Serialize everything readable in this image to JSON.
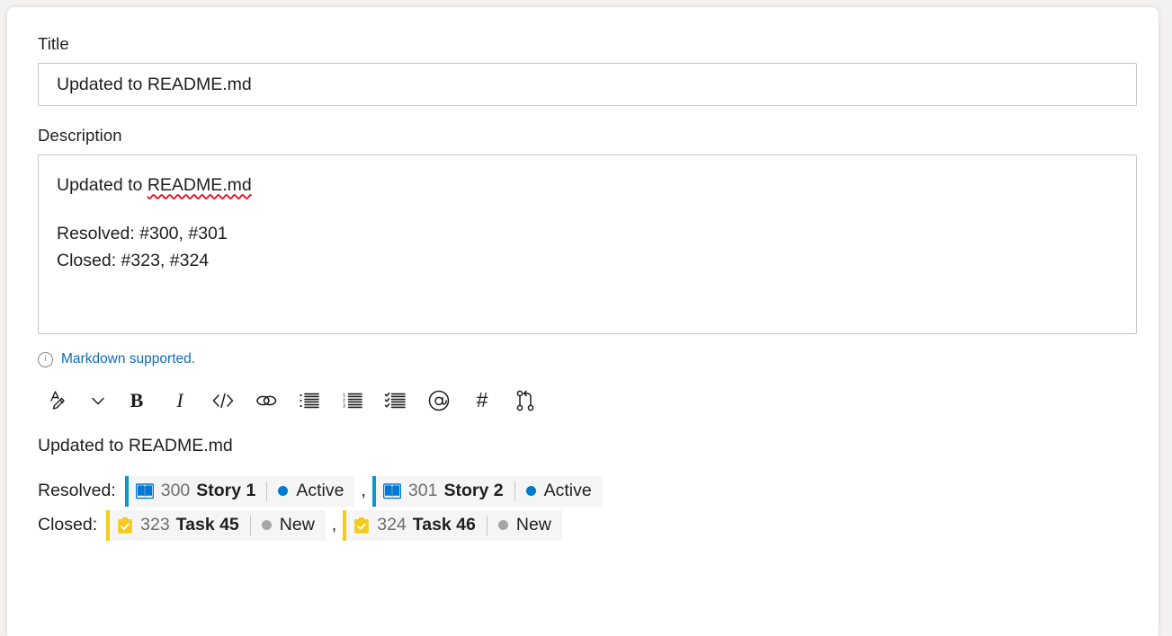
{
  "form": {
    "title_label": "Title",
    "title_value": "Updated to README.md",
    "title_placeholder": "Enter a title",
    "description_label": "Description",
    "description_line1_prefix": "Updated to ",
    "description_line1_misspelled": "README.md",
    "description_line2": "Resolved: #300, #301",
    "description_line3": "Closed: #323, #324",
    "markdown_note": "Markdown supported.",
    "info_icon_glyph": "i"
  },
  "toolbar": {
    "items": [
      {
        "name": "font-style-icon",
        "label": "Font style"
      },
      {
        "name": "chevron-down-icon",
        "label": "More font options"
      },
      {
        "name": "bold-icon",
        "label": "Bold",
        "glyph": "B"
      },
      {
        "name": "italic-icon",
        "label": "Italic",
        "glyph": "I"
      },
      {
        "name": "code-icon",
        "label": "Code",
        "glyph": "</>"
      },
      {
        "name": "link-icon",
        "label": "Link"
      },
      {
        "name": "bulleted-list-icon",
        "label": "Bulleted list"
      },
      {
        "name": "numbered-list-icon",
        "label": "Numbered list"
      },
      {
        "name": "checklist-icon",
        "label": "Checklist"
      },
      {
        "name": "mention-icon",
        "label": "Mention",
        "glyph": "@"
      },
      {
        "name": "hashtag-icon",
        "label": "Work item link",
        "glyph": "#"
      },
      {
        "name": "pull-request-icon",
        "label": "Pull request link"
      }
    ]
  },
  "preview": {
    "paragraph": "Updated to README.md",
    "rows": [
      {
        "label": "Resolved:",
        "chips": [
          {
            "type": "story",
            "icon": "story-book-icon",
            "id": "300",
            "title": "Story 1",
            "state": "Active",
            "state_color": "#007acc",
            "accent_color": "#009ccc"
          },
          {
            "type": "story",
            "icon": "story-book-icon",
            "id": "301",
            "title": "Story 2",
            "state": "Active",
            "state_color": "#007acc",
            "accent_color": "#009ccc"
          }
        ]
      },
      {
        "label": "Closed:",
        "chips": [
          {
            "type": "task",
            "icon": "task-clipboard-check-icon",
            "id": "323",
            "title": "Task 45",
            "state": "New",
            "state_color": "#a6a6a6",
            "accent_color": "#f2cb1d"
          },
          {
            "type": "task",
            "icon": "task-clipboard-check-icon",
            "id": "324",
            "title": "Task 46",
            "state": "New",
            "state_color": "#a6a6a6",
            "accent_color": "#f2cb1d"
          }
        ]
      }
    ],
    "separator": ","
  },
  "colors": {
    "accent_link": "#0f6cbd",
    "story_accent": "#009ccc",
    "task_accent": "#f2cb1d",
    "chip_bg": "#f5f5f5",
    "border": "#c8c6c4",
    "spellcheck": "#e81123"
  }
}
